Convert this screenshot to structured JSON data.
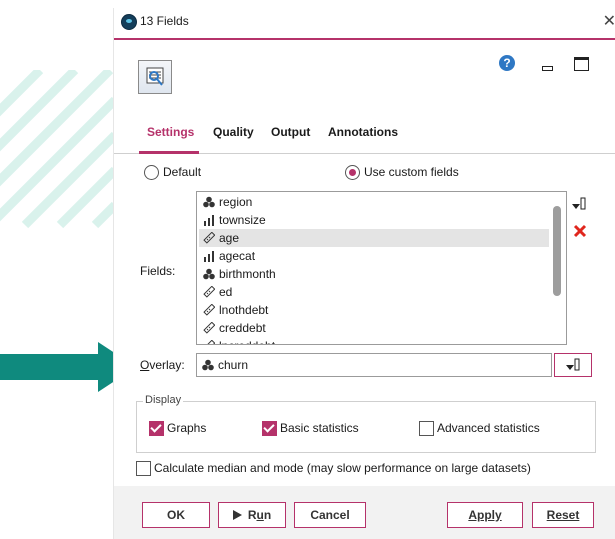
{
  "window": {
    "title": "13 Fields",
    "close_label": "✕"
  },
  "toolbar": {
    "help_label": "?"
  },
  "tabs": [
    {
      "label": "Settings",
      "active": true
    },
    {
      "label": "Quality",
      "active": false
    },
    {
      "label": "Output",
      "active": false
    },
    {
      "label": "Annotations",
      "active": false
    }
  ],
  "field_mode": {
    "default_label": "Default",
    "custom_label": "Use custom fields",
    "selected": "custom"
  },
  "fields": {
    "label": "Fields:",
    "items": [
      {
        "name": "region",
        "type": "nominal",
        "selected": false
      },
      {
        "name": "townsize",
        "type": "ordinal",
        "selected": false
      },
      {
        "name": "age",
        "type": "continuous",
        "selected": true
      },
      {
        "name": "agecat",
        "type": "ordinal",
        "selected": false
      },
      {
        "name": "birthmonth",
        "type": "nominal",
        "selected": false
      },
      {
        "name": "ed",
        "type": "continuous",
        "selected": false
      },
      {
        "name": "lnothdebt",
        "type": "continuous",
        "selected": false
      },
      {
        "name": "creddebt",
        "type": "continuous",
        "selected": false
      },
      {
        "name": "lncreddebt",
        "type": "continuous",
        "selected": false
      }
    ]
  },
  "overlay": {
    "label_u": "O",
    "label_rest": "verlay:",
    "value": "churn",
    "type": "nominal"
  },
  "display": {
    "legend": "Display",
    "graphs": {
      "label": "Graphs",
      "checked": true
    },
    "basic_stats": {
      "label": "Basic statistics",
      "checked": true
    },
    "advanced_stats": {
      "label": "Advanced statistics",
      "checked": false
    }
  },
  "median_mode": {
    "label": "Calculate median and mode (may slow performance on large datasets)",
    "checked": false
  },
  "buttons": {
    "ok": "OK",
    "run_pre": "R",
    "run_u": "u",
    "run_post": "n",
    "cancel": "Cancel",
    "apply": "Apply",
    "reset": "Reset"
  },
  "colors": {
    "accent": "#b5326a",
    "teal_arrow": "#0f8a7e",
    "deco": "#d9f2ec"
  }
}
